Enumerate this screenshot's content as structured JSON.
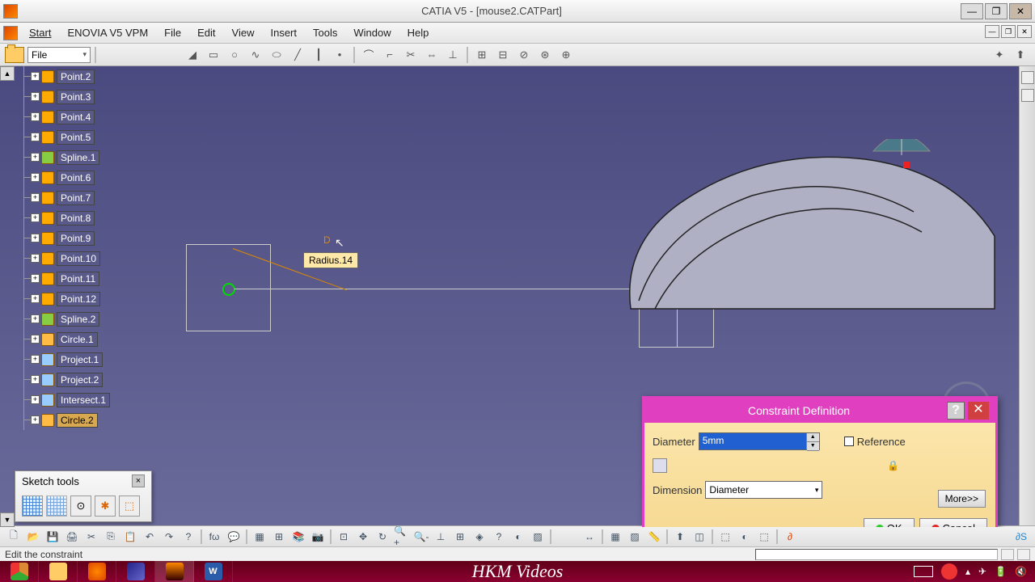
{
  "window": {
    "title": "CATIA V5 - [mouse2.CATPart]",
    "minimize": "—",
    "maximize": "❐",
    "close": "✕"
  },
  "menu": {
    "start": "Start",
    "enovia": "ENOVIA V5 VPM",
    "file": "File",
    "edit": "Edit",
    "view": "View",
    "insert": "Insert",
    "tools": "Tools",
    "window": "Window",
    "help": "Help"
  },
  "file_combo": "File",
  "tree": {
    "items": [
      {
        "label": "Point.2",
        "type": "point"
      },
      {
        "label": "Point.3",
        "type": "point"
      },
      {
        "label": "Point.4",
        "type": "point"
      },
      {
        "label": "Point.5",
        "type": "point"
      },
      {
        "label": "Spline.1",
        "type": "spline"
      },
      {
        "label": "Point.6",
        "type": "point"
      },
      {
        "label": "Point.7",
        "type": "point"
      },
      {
        "label": "Point.8",
        "type": "point"
      },
      {
        "label": "Point.9",
        "type": "point"
      },
      {
        "label": "Point.10",
        "type": "point"
      },
      {
        "label": "Point.11",
        "type": "point"
      },
      {
        "label": "Point.12",
        "type": "point"
      },
      {
        "label": "Spline.2",
        "type": "spline"
      },
      {
        "label": "Circle.1",
        "type": "circle"
      },
      {
        "label": "Project.1",
        "type": "proj"
      },
      {
        "label": "Project.2",
        "type": "proj"
      },
      {
        "label": "Intersect.1",
        "type": "proj"
      },
      {
        "label": "Circle.2",
        "type": "circle",
        "selected": true
      }
    ]
  },
  "canvas": {
    "tooltip": "Radius.14",
    "cursor_label": "D"
  },
  "sketch_tools": {
    "title": "Sketch tools",
    "close": "×"
  },
  "dialog": {
    "title": "Constraint Definition",
    "help": "?",
    "close": "✕",
    "diameter_label": "Diameter",
    "diameter_value": "5mm",
    "reference_label": "Reference",
    "dimension_label": "Dimension",
    "dimension_value": "Diameter",
    "more": "More>>",
    "ok": "OK",
    "cancel": "Cancel"
  },
  "status": {
    "message": "Edit the constraint"
  },
  "watermark": "HKM Videos",
  "scroll": {
    "up": "▲",
    "down": "▼"
  }
}
